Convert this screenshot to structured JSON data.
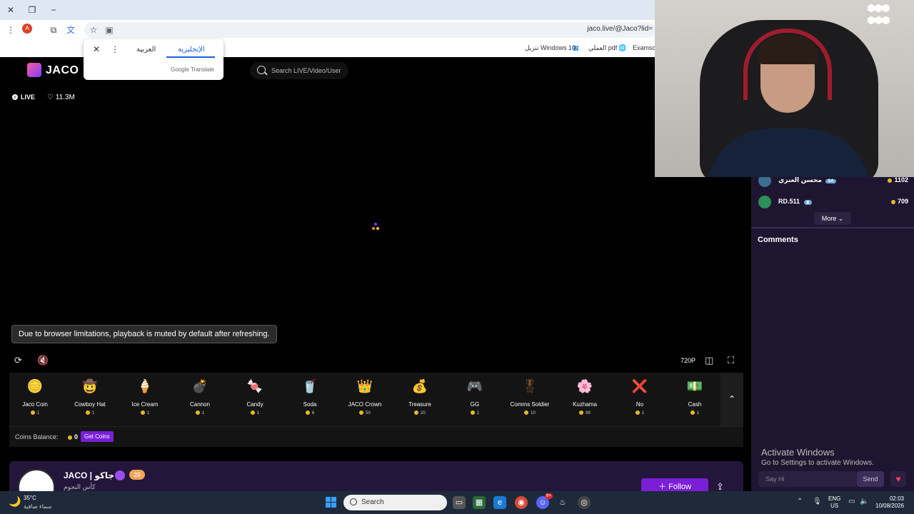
{
  "browser": {
    "url": "jaco.live/@Jaco?lid=",
    "profile_initial": "A",
    "bookmarks": [
      "Examsof",
      "العملي pdf",
      "تنزيل Windows 10"
    ]
  },
  "translate_popup": {
    "lang_source": "العربية",
    "lang_target": "الإنجليزية",
    "credit": "Google Translate"
  },
  "site": {
    "logo": "JACO",
    "search_placeholder": "Search LIVE/Video/User",
    "live_label": "LIVE",
    "likes": "11.3M"
  },
  "player": {
    "toast": "Due to browser limitations, playback is muted by default after refreshing.",
    "quality": "720P"
  },
  "gifts": [
    {
      "name": "Jaco Coin",
      "price": "1",
      "icon": "🪙",
      "color": "#e8b923"
    },
    {
      "name": "Cowboy Hat",
      "price": "1",
      "icon": "🤠",
      "color": "#7a4b2a"
    },
    {
      "name": "Ice Cream",
      "price": "1",
      "icon": "🍦",
      "color": "#f5d6c6"
    },
    {
      "name": "Cannon",
      "price": "1",
      "icon": "💣",
      "color": "#555555"
    },
    {
      "name": "Candy",
      "price": "1",
      "icon": "🍬",
      "color": "#e88a4a"
    },
    {
      "name": "Soda",
      "price": "6",
      "icon": "🥤",
      "color": "#6bd16b"
    },
    {
      "name": "JACO Crown",
      "price": "50",
      "icon": "👑",
      "color": "#b08ad6"
    },
    {
      "name": "Treasure",
      "price": "20",
      "icon": "💰",
      "color": "#8a6a3a"
    },
    {
      "name": "GG",
      "price": "1",
      "icon": "🎮",
      "color": "#e84a4a"
    },
    {
      "name": "Comms Soldier",
      "price": "10",
      "icon": "🎖",
      "color": "#7a4a2a"
    },
    {
      "name": "Kuzhama",
      "price": "99",
      "icon": "🌸",
      "color": "#b08ad6"
    },
    {
      "name": "No",
      "price": "1",
      "icon": "❌",
      "color": "#e02020"
    },
    {
      "name": "Cash",
      "price": "1",
      "icon": "💵",
      "color": "#d6a84a"
    }
  ],
  "coins": {
    "label": "Coins Balance:",
    "value": "0",
    "get_coins": "Get Coins"
  },
  "profile": {
    "name": "JACO | جاكو",
    "level": "26",
    "subtitle": "كأس النجوم",
    "follow": "Follow"
  },
  "ranking": [
    {
      "name": "محسن العنزي",
      "badge": "SA",
      "coins": "1102"
    },
    {
      "name": "RD.511",
      "badge": "",
      "coins": "709"
    }
  ],
  "panel": {
    "more": "More",
    "comments_title": "Comments",
    "comment_placeholder": "Say Hi",
    "send": "Send"
  },
  "activate": {
    "title": "Activate Windows",
    "subtitle": "Go to Settings to activate Windows."
  },
  "taskbar": {
    "temp": "35°C",
    "weather": "سماء صافية",
    "search": "Search",
    "lang_top": "ENG",
    "lang_bottom": "US",
    "time": "02:03",
    "date": "10/08/2026",
    "discord_badge": "9+"
  }
}
